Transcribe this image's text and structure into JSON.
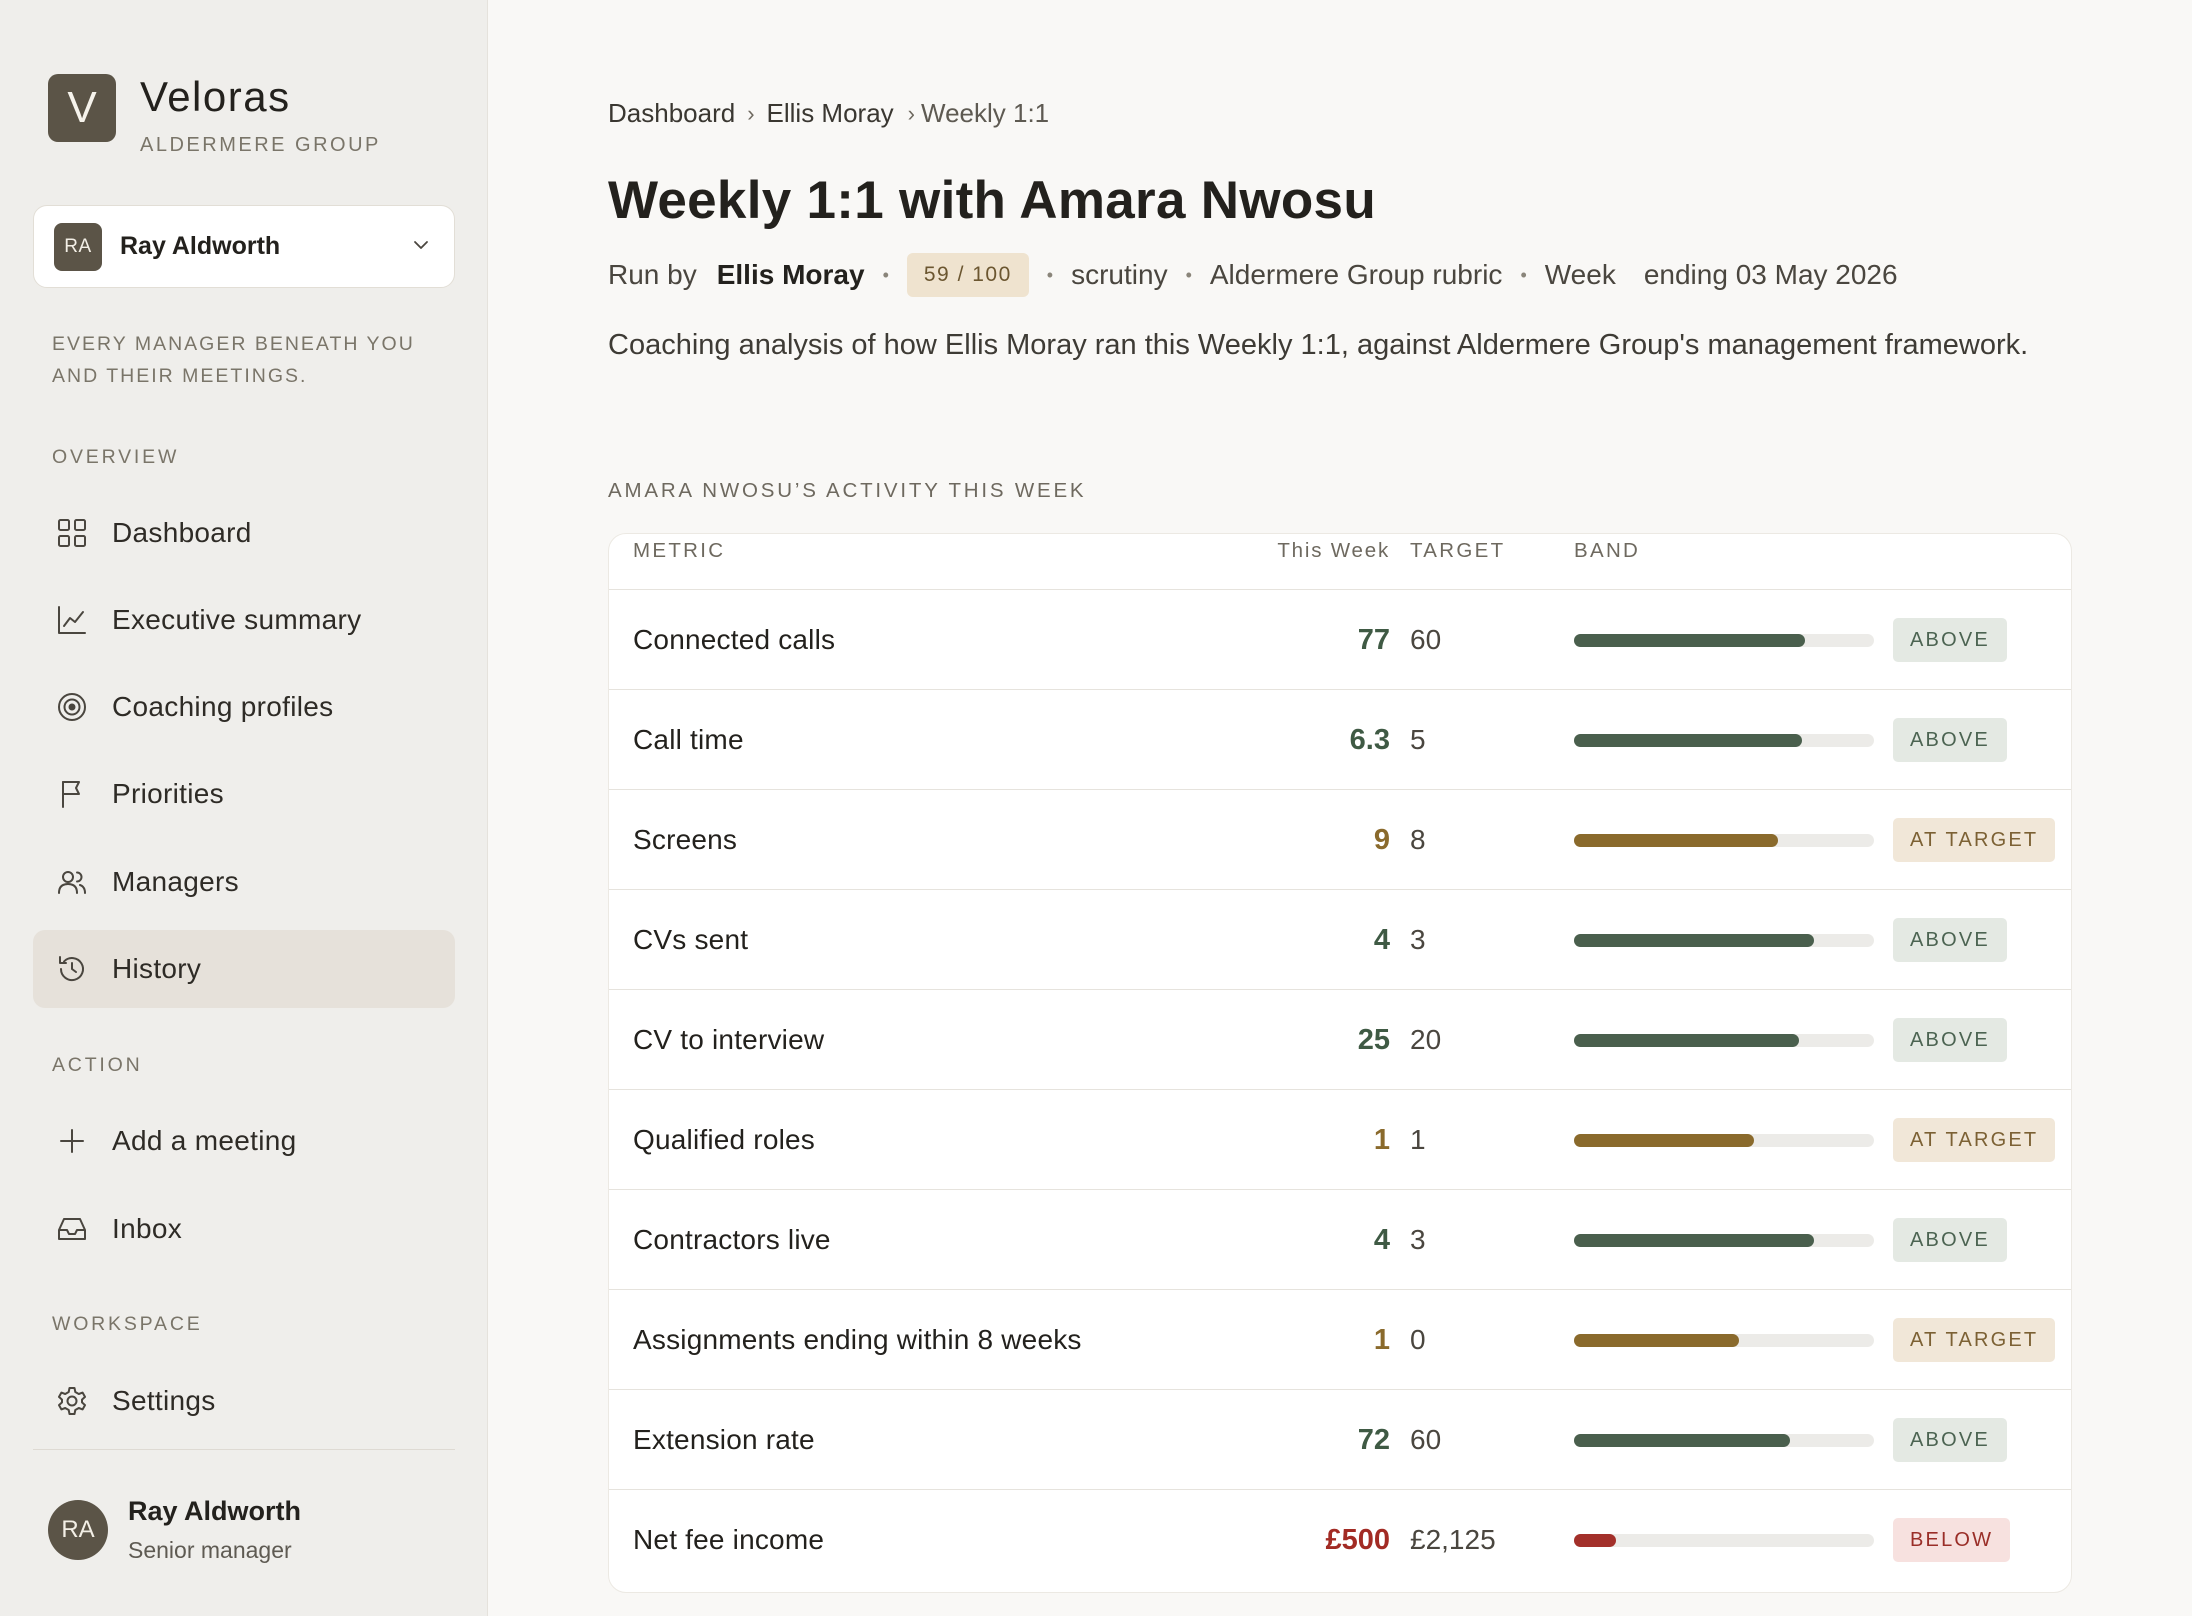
{
  "app": {
    "logo_letter": "V",
    "name": "Veloras",
    "org": "ALDERMERE GROUP"
  },
  "user_selector": {
    "initials": "RA",
    "name": "Ray Aldworth"
  },
  "sidebar": {
    "tagline": "EVERY MANAGER BENEATH YOU AND THEIR MEETINGS.",
    "sections": {
      "overview": "OVERVIEW",
      "action": "ACTION",
      "workspace": "WORKSPACE"
    },
    "items": {
      "dashboard": {
        "label": "Dashboard",
        "icon": "grid-icon"
      },
      "executive_summary": {
        "label": "Executive summary",
        "icon": "line-chart-icon"
      },
      "coaching_profiles": {
        "label": "Coaching profiles",
        "icon": "target-icon"
      },
      "priorities": {
        "label": "Priorities",
        "icon": "flag-icon"
      },
      "managers": {
        "label": "Managers",
        "icon": "users-icon"
      },
      "history": {
        "label": "History",
        "icon": "history-icon",
        "active": true
      },
      "add_meeting": {
        "label": "Add a meeting",
        "icon": "plus-icon"
      },
      "inbox": {
        "label": "Inbox",
        "icon": "inbox-icon"
      },
      "settings": {
        "label": "Settings",
        "icon": "gear-icon"
      }
    },
    "profile": {
      "initials": "RA",
      "name": "Ray Aldworth",
      "role": "Senior manager"
    }
  },
  "breadcrumb": {
    "items": [
      "Dashboard",
      "Ellis Moray",
      "Weekly 1:1"
    ],
    "separator": "›"
  },
  "page": {
    "title": "Weekly 1:1 with Amara Nwosu",
    "meta": {
      "run_by_label": "Run by",
      "run_by_name": "Ellis Moray",
      "score": "59 / 100",
      "mode": "scrutiny",
      "rubric": "Aldermere Group rubric",
      "week_label": "Week",
      "week_ending": "ending 03 May 2026",
      "separator": "•"
    },
    "description": "Coaching analysis of how Ellis Moray ran this Weekly 1:1, against Aldermere Group's management framework."
  },
  "activity": {
    "section_title": "AMARA NWOSU’S ACTIVITY THIS WEEK",
    "columns": {
      "metric": "METRIC",
      "this_week": "This Week",
      "target": "TARGET",
      "band": "BAND"
    },
    "rows": [
      {
        "metric": "Connected calls",
        "this_week": "77",
        "target": "60",
        "band": "ABOVE",
        "fill": 0.77
      },
      {
        "metric": "Call time",
        "this_week": "6.3",
        "target": "5",
        "band": "ABOVE",
        "fill": 0.76
      },
      {
        "metric": "Screens",
        "this_week": "9",
        "target": "8",
        "band": "AT TARGET",
        "fill": 0.68
      },
      {
        "metric": "CVs sent",
        "this_week": "4",
        "target": "3",
        "band": "ABOVE",
        "fill": 0.8
      },
      {
        "metric": "CV to interview",
        "this_week": "25",
        "target": "20",
        "band": "ABOVE",
        "fill": 0.75
      },
      {
        "metric": "Qualified roles",
        "this_week": "1",
        "target": "1",
        "band": "AT TARGET",
        "fill": 0.6
      },
      {
        "metric": "Contractors live",
        "this_week": "4",
        "target": "3",
        "band": "ABOVE",
        "fill": 0.8
      },
      {
        "metric": "Assignments ending within 8 weeks",
        "this_week": "1",
        "target": "0",
        "band": "AT TARGET",
        "fill": 0.55
      },
      {
        "metric": "Extension rate",
        "this_week": "72",
        "target": "60",
        "band": "ABOVE",
        "fill": 0.72
      },
      {
        "metric": "Net fee income",
        "this_week": "£500",
        "target": "£2,125",
        "band": "BELOW",
        "fill": 0.14
      }
    ]
  },
  "colors": {
    "above": "#4a5f4d",
    "at_target": "#8a6a2c",
    "below": "#a3302a",
    "accent_dark": "#5b5447"
  }
}
